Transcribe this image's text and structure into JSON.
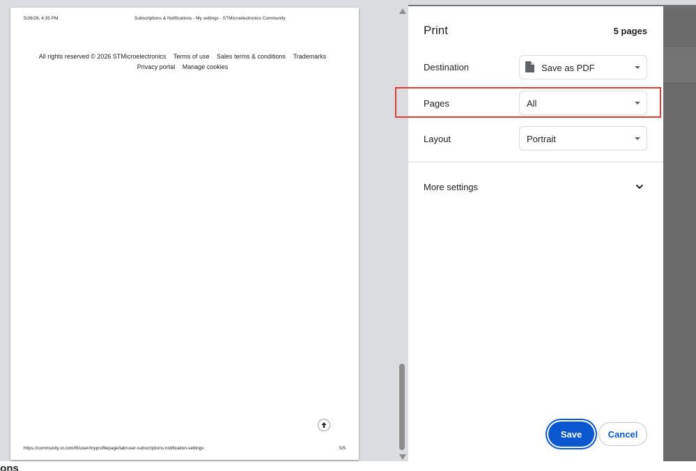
{
  "background": {
    "partial_heading": "ions"
  },
  "preview": {
    "header_date": "5/26/26, 4:35 PM",
    "header_title": "Subscriptions & Notifications - My settings - STMicroelectronics Community",
    "footer_links": [
      "All rights reserved © 2026 STMicroelectronics",
      "Terms of use",
      "Sales terms & conditions",
      "Trademarks",
      "Privacy portal",
      "Manage cookies"
    ],
    "footer_url": "https://community.st.com/t5/user/myprofilepage/tab/user-subscriptions:notification-settings",
    "page_number": "5/5",
    "back_to_top_icon": "arrow-up-icon"
  },
  "print_panel": {
    "title": "Print",
    "page_count": "5 pages",
    "destination": {
      "label": "Destination",
      "value": "Save as PDF",
      "icon": "document-icon"
    },
    "pages": {
      "label": "Pages",
      "value": "All"
    },
    "layout": {
      "label": "Layout",
      "value": "Portrait"
    },
    "more_settings": {
      "label": "More settings",
      "icon": "chevron-down-icon"
    },
    "save_label": "Save",
    "cancel_label": "Cancel"
  },
  "colors": {
    "accent": "#0b57d0",
    "highlight_border": "#e53935",
    "preview_background": "#dadce0"
  }
}
